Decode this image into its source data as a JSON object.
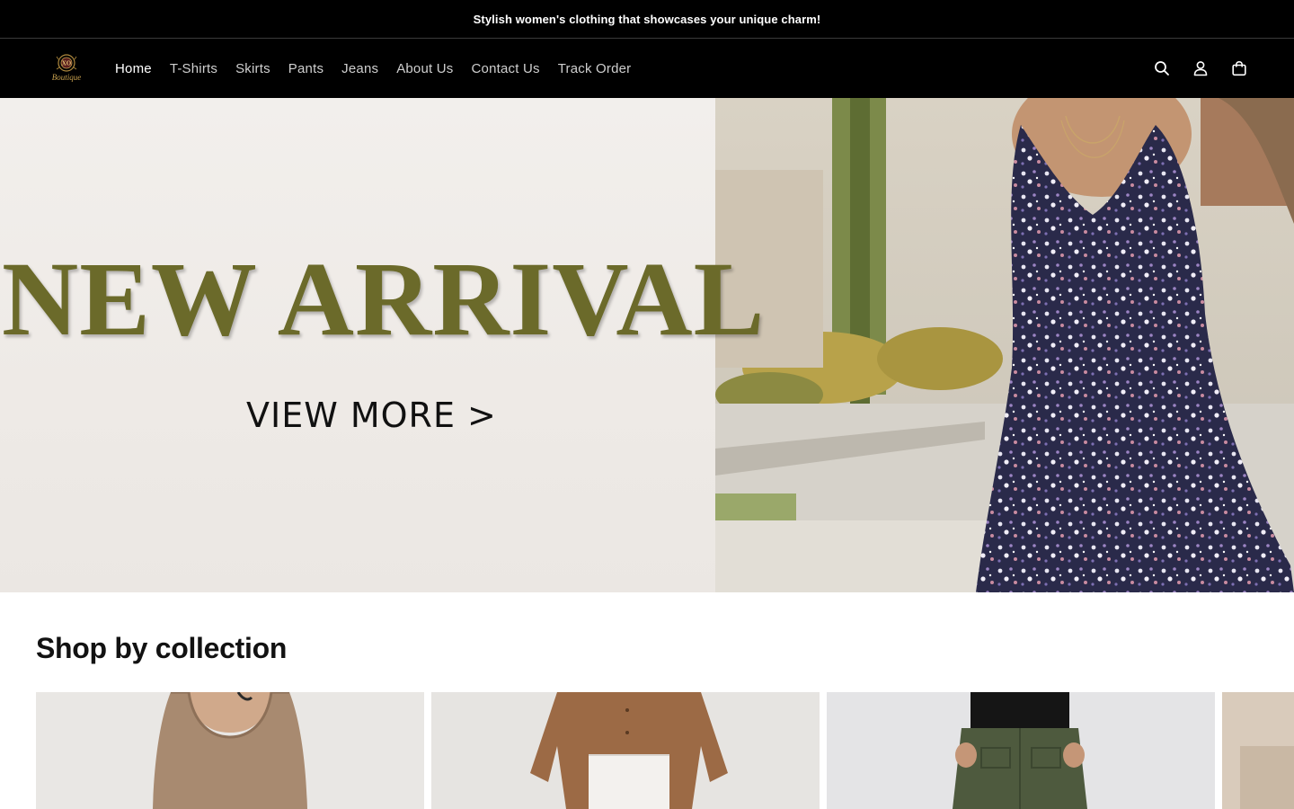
{
  "announcement": {
    "text": "Stylish women's clothing that showcases your unique charm!"
  },
  "header": {
    "logo": {
      "alt": "Boutique",
      "icon": "boutique-logo"
    },
    "nav": [
      {
        "label": "Home",
        "active": true
      },
      {
        "label": "T-Shirts",
        "active": false
      },
      {
        "label": "Skirts",
        "active": false
      },
      {
        "label": "Pants",
        "active": false
      },
      {
        "label": "Jeans",
        "active": false
      },
      {
        "label": "About Us",
        "active": false
      },
      {
        "label": "Contact Us",
        "active": false
      },
      {
        "label": "Track Order",
        "active": false
      }
    ],
    "icons": [
      "search-icon",
      "account-icon",
      "cart-icon"
    ]
  },
  "hero": {
    "title": "NEW ARRIVAL",
    "cta": "VIEW MORE >"
  },
  "collections": {
    "title": "Shop by collection",
    "items": [
      {
        "name": "tank-top-collection"
      },
      {
        "name": "shirts-collection"
      },
      {
        "name": "pants-collection"
      },
      {
        "name": "fourth-collection"
      }
    ]
  },
  "colors": {
    "bar": "#000000",
    "accent_text": "#6b6a2a",
    "nav_text": "#cfcfcf",
    "nav_active": "#ffffff"
  }
}
